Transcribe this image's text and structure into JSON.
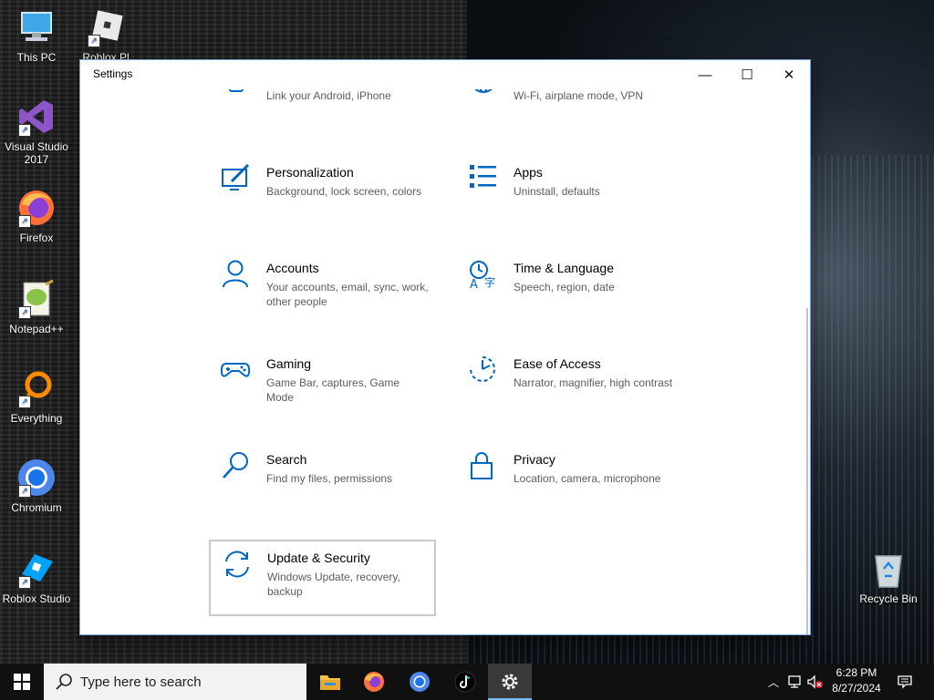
{
  "desktop": {
    "icons": [
      {
        "label": "This PC"
      },
      {
        "label": "Roblox Pl"
      },
      {
        "label": "Visual Studio 2017"
      },
      {
        "label": "Firefox"
      },
      {
        "label": "Notepad++"
      },
      {
        "label": "Everything"
      },
      {
        "label": "Chromium"
      },
      {
        "label": "Roblox Studio"
      },
      {
        "label": "Recycle Bin"
      }
    ]
  },
  "window": {
    "title": "Settings",
    "controls": {
      "minimize": "—",
      "maximize": "☐",
      "close": "✕"
    }
  },
  "tiles": [
    {
      "title": "",
      "desc": "Link your Android, iPhone",
      "icon": "phone-icon"
    },
    {
      "title": "",
      "desc": "Wi-Fi, airplane mode, VPN",
      "icon": "globe-icon"
    },
    {
      "title": "Personalization",
      "desc": "Background, lock screen, colors",
      "icon": "personalization-icon"
    },
    {
      "title": "Apps",
      "desc": "Uninstall, defaults",
      "icon": "apps-icon"
    },
    {
      "title": "Accounts",
      "desc": "Your accounts, email, sync, work, other people",
      "icon": "person-icon"
    },
    {
      "title": "Time & Language",
      "desc": "Speech, region, date",
      "icon": "time-language-icon"
    },
    {
      "title": "Gaming",
      "desc": "Game Bar, captures, Game Mode",
      "icon": "gamepad-icon"
    },
    {
      "title": "Ease of Access",
      "desc": "Narrator, magnifier, high contrast",
      "icon": "ease-of-access-icon"
    },
    {
      "title": "Search",
      "desc": "Find my files, permissions",
      "icon": "search-icon"
    },
    {
      "title": "Privacy",
      "desc": "Location, camera, microphone",
      "icon": "lock-icon"
    },
    {
      "title": "Update & Security",
      "desc": "Windows Update, recovery, backup",
      "icon": "update-icon"
    }
  ],
  "taskbar": {
    "search_placeholder": "Type here to search",
    "time": "6:28 PM",
    "date": "8/27/2024"
  },
  "colors": {
    "accent": "#0067c0",
    "taskbar": "#101010"
  }
}
